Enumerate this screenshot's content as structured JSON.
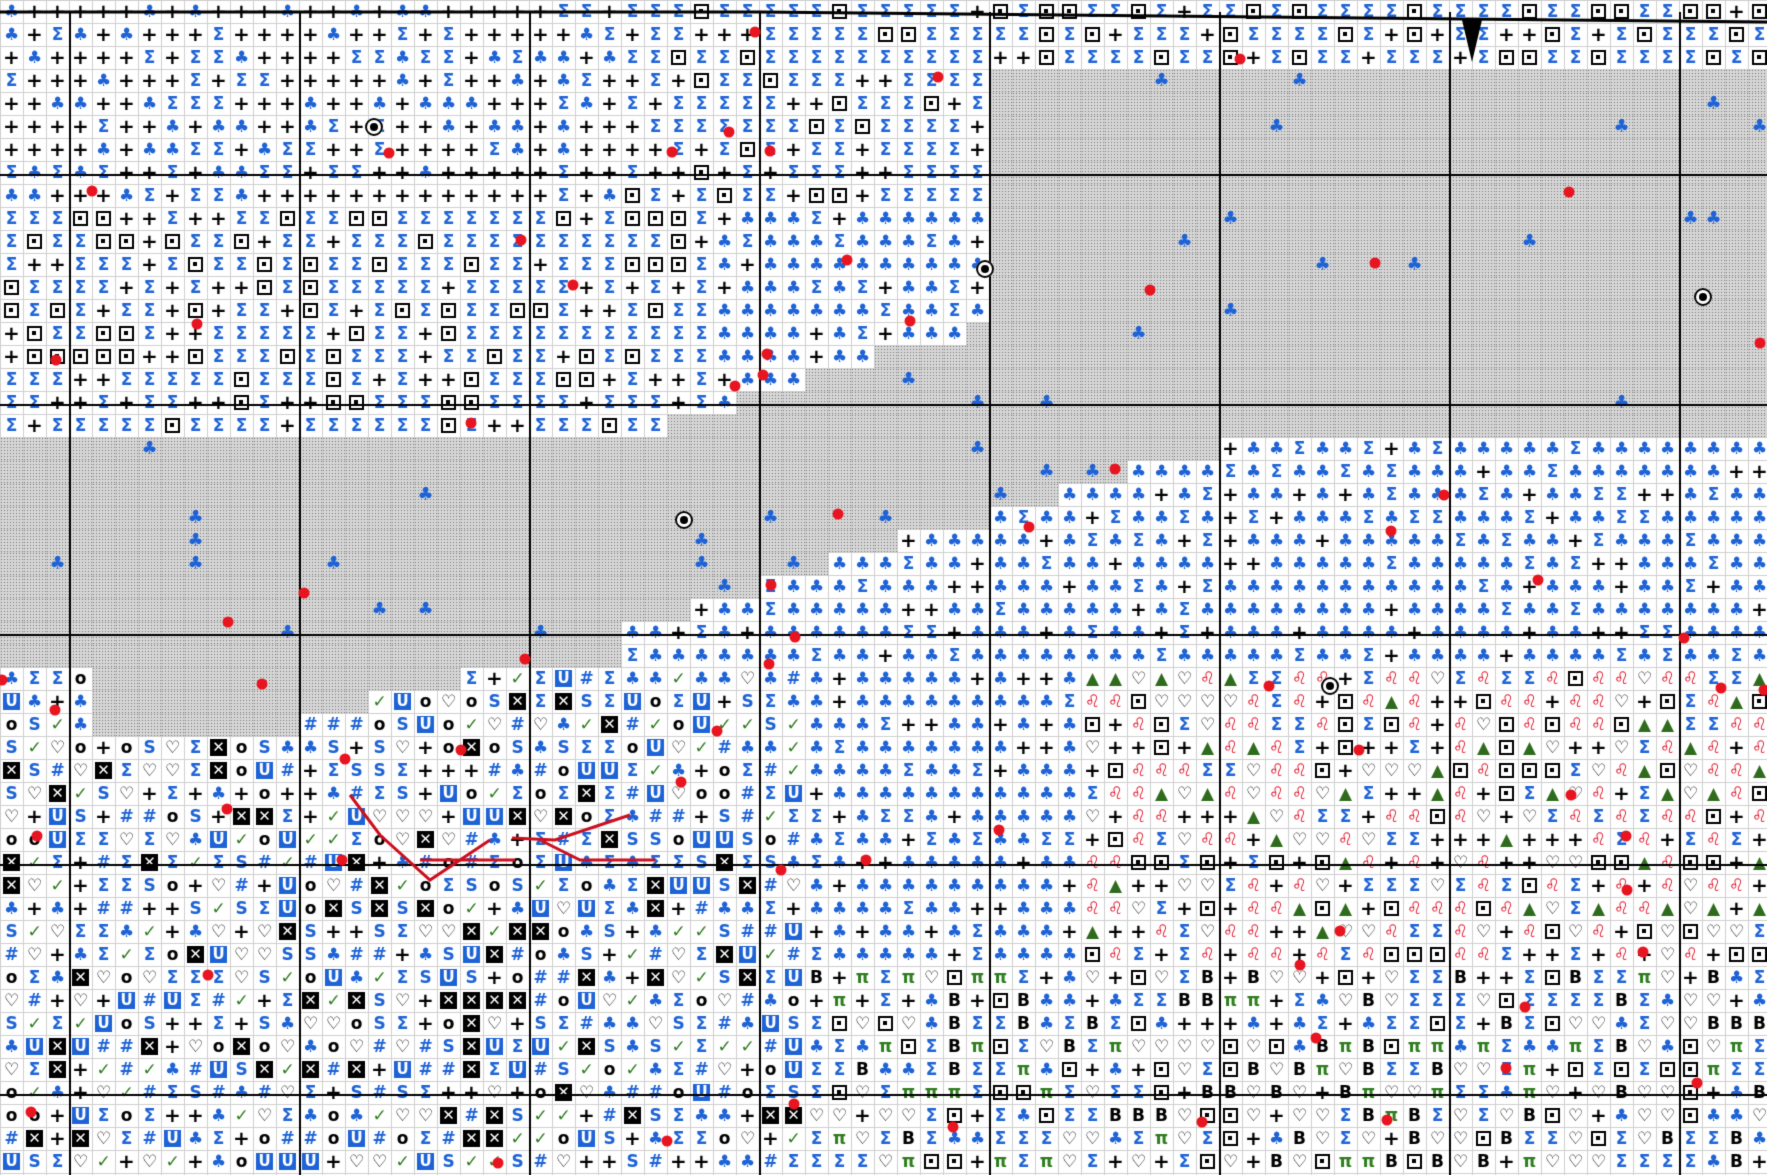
{
  "chart_title": "",
  "symbols": [
    {
      "key": "club",
      "glyph": "♣",
      "color": "#1e63d6"
    },
    {
      "key": "plus",
      "glyph": "+",
      "color": "#000000"
    },
    {
      "key": "sigma",
      "glyph": "Σ",
      "color": "#1e63d6"
    },
    {
      "key": "corner",
      "glyph": "◘",
      "color": "#000000"
    },
    {
      "key": "heart",
      "glyph": "♡",
      "color": "#000000"
    },
    {
      "key": "tri",
      "glyph": "▲",
      "color": "#2f6b1d"
    },
    {
      "key": "leo",
      "glyph": "♌",
      "color": "#e0162b"
    },
    {
      "key": "S",
      "glyph": "S",
      "color": "#1e63d6"
    },
    {
      "key": "U",
      "glyph": "U",
      "color": "#1e63d6"
    },
    {
      "key": "X",
      "glyph": "X",
      "color": "#000000"
    },
    {
      "key": "check",
      "glyph": "✓",
      "color": "#2f7d1f"
    },
    {
      "key": "ring",
      "glyph": "o",
      "color": "#000000"
    },
    {
      "key": "hash",
      "glyph": "#",
      "color": "#1e63d6"
    },
    {
      "key": "pi",
      "glyph": "π",
      "color": "#2f7d1f"
    },
    {
      "key": "B",
      "glyph": "B",
      "color": "#000000"
    },
    {
      "key": "star",
      "glyph": "★",
      "color": "#000000"
    }
  ],
  "colors": {
    "red_dot": "#e8141f",
    "grid_minor": "#cfcfcf",
    "grid_major": "#000000",
    "shade": "#bdbdbd"
  }
}
